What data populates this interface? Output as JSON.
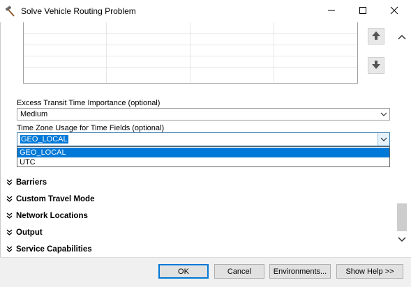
{
  "window": {
    "title": "Solve Vehicle Routing Problem",
    "title_icon": "hammer-tool-icon",
    "minimize_icon": "minimize-icon",
    "maximize_icon": "maximize-icon",
    "close_icon": "close-icon"
  },
  "parameters": {
    "excess_transit": {
      "label": "Excess Transit Time Importance (optional)",
      "value": "Medium"
    },
    "time_zone": {
      "label": "Time Zone Usage for Time Fields (optional)",
      "value": "GEO_LOCAL",
      "options": [
        "GEO_LOCAL",
        "UTC"
      ],
      "highlighted_option": "GEO_LOCAL"
    }
  },
  "sections": [
    {
      "label": "Barriers"
    },
    {
      "label": "Custom Travel Mode"
    },
    {
      "label": "Network Locations"
    },
    {
      "label": "Output"
    },
    {
      "label": "Service Capabilities"
    }
  ],
  "buttons": {
    "ok": "OK",
    "cancel": "Cancel",
    "environments": "Environments...",
    "show_help": "Show Help >>"
  },
  "colors": {
    "selection": "#0078d7",
    "footer_bg": "#f0f0f0"
  }
}
